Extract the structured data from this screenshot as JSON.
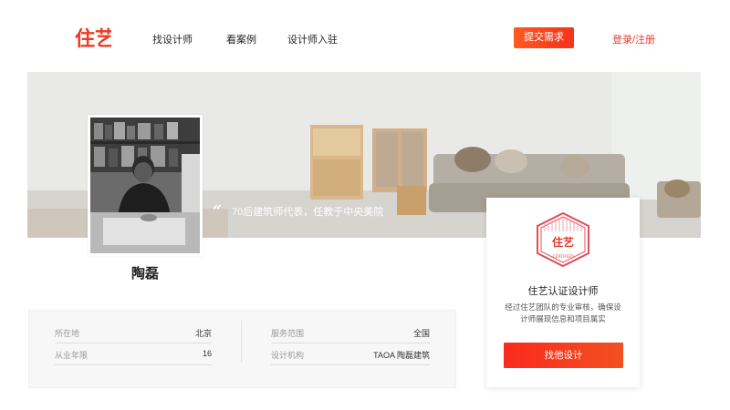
{
  "header": {
    "logo_text": "住艺",
    "nav": [
      "找设计师",
      "看案例",
      "设计师入驻"
    ],
    "submit_label": "提交需求",
    "login_label": "登录/注册"
  },
  "banner": {
    "tagline": "70后建筑师代表，任教于中央美院"
  },
  "designer": {
    "name": "陶磊"
  },
  "info": {
    "location_label": "所在地",
    "location_value": "北京",
    "years_label": "从业年限",
    "years_value": "16",
    "service_label": "服务范围",
    "service_value": "全国",
    "org_label": "设计机构",
    "org_value": "TAOA 陶磊建筑"
  },
  "certification": {
    "badge_text": "住艺",
    "badge_sub": "CERTIFIED",
    "title": "住艺认证设计师",
    "desc": "经过住艺团队的专业审核，确保设计师展现信息和项目属实",
    "button_label": "找他设计"
  },
  "colors": {
    "brand_red": "#f03a24",
    "button_orange": "#ff5a1f"
  }
}
